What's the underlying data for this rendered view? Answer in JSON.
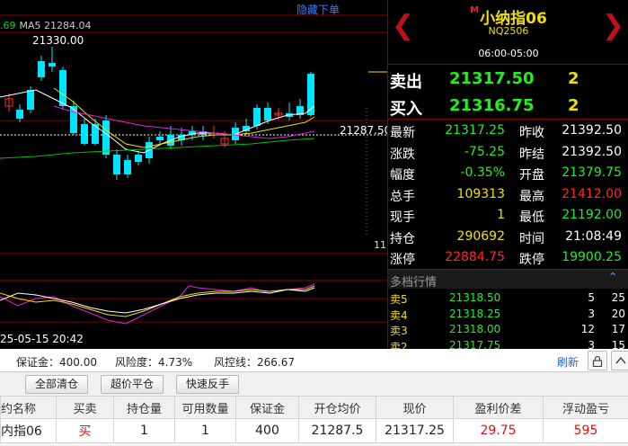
{
  "chart": {
    "hide_order_label": "隐藏下单",
    "ma_legend_value": ".69",
    "ma_legend_ma5": "MA5 21284.04",
    "high_label": "21330.00",
    "last_price_tag": "21287.50",
    "volume_tick": "11",
    "date_label": "25-05-15 20:42",
    "colors": {
      "up": "#ff3030",
      "down": "#00e5ff",
      "ma5": "#ffffff",
      "ma10": "#f0e000",
      "ma20": "#e020e0",
      "ma60": "#00c000",
      "grid": "#8a0000"
    }
  },
  "quote": {
    "name": "小纳指06",
    "badge": "M",
    "code": "NQ2506",
    "session": "06:00-05:00",
    "ask_label": "卖出",
    "ask_price": "21317.50",
    "ask_qty": "2",
    "bid_label": "买入",
    "bid_price": "21316.75",
    "bid_qty": "2",
    "rows": [
      {
        "l1": "最新",
        "v1": "21317.25",
        "c1": "green",
        "l2": "昨收",
        "v2": "21392.50",
        "c2": "white"
      },
      {
        "l1": "涨跌",
        "v1": "-75.25",
        "c1": "green",
        "l2": "昨结",
        "v2": "21392.50",
        "c2": "white"
      },
      {
        "l1": "幅度",
        "v1": "-0.35%",
        "c1": "green",
        "l2": "开盘",
        "v2": "21379.75",
        "c2": "green"
      },
      {
        "l1": "总手",
        "v1": "109313",
        "c1": "yellow",
        "l2": "最高",
        "v2": "21412.00",
        "c2": "red"
      },
      {
        "l1": "现手",
        "v1": "1",
        "c1": "yellow",
        "l2": "最低",
        "v2": "21192.00",
        "c2": "green"
      },
      {
        "l1": "持仓",
        "v1": "290692",
        "c1": "yellow",
        "l2": "时间",
        "v2": "21:08:49",
        "c2": "white"
      },
      {
        "l1": "涨停",
        "v1": "22884.75",
        "c1": "red",
        "l2": "跌停",
        "v2": "19900.25",
        "c2": "green"
      }
    ],
    "depth_title": "多档行情",
    "depth": [
      {
        "label": "卖5",
        "price": "21318.50",
        "qty": "5",
        "num": "25"
      },
      {
        "label": "卖4",
        "price": "21318.25",
        "qty": "3",
        "num": "20"
      },
      {
        "label": "卖3",
        "price": "21318.00",
        "qty": "12",
        "num": "17"
      },
      {
        "label": "卖2",
        "price": "21317.75",
        "qty": "3",
        "num": "15"
      }
    ]
  },
  "trade": {
    "margin_label": "保证金：400.00",
    "risk_label": "风险度：4.73%",
    "riskline_label": "风控线：266.67",
    "refresh_label": "刷新",
    "buttons": [
      "全部清仓",
      "超价平仓",
      "快速反手"
    ],
    "columns": [
      "约名称",
      "买卖",
      "持仓量",
      "可用数量",
      "保证金",
      "开仓均价",
      "现价",
      "盈利价差",
      "浮动盈亏"
    ],
    "positions": [
      {
        "name": "内指06",
        "side": "买",
        "qty": "1",
        "avail": "1",
        "margin": "400",
        "open_avg": "21287.5",
        "price": "21317.25",
        "diff": "29.75",
        "pnl": "595"
      }
    ]
  }
}
